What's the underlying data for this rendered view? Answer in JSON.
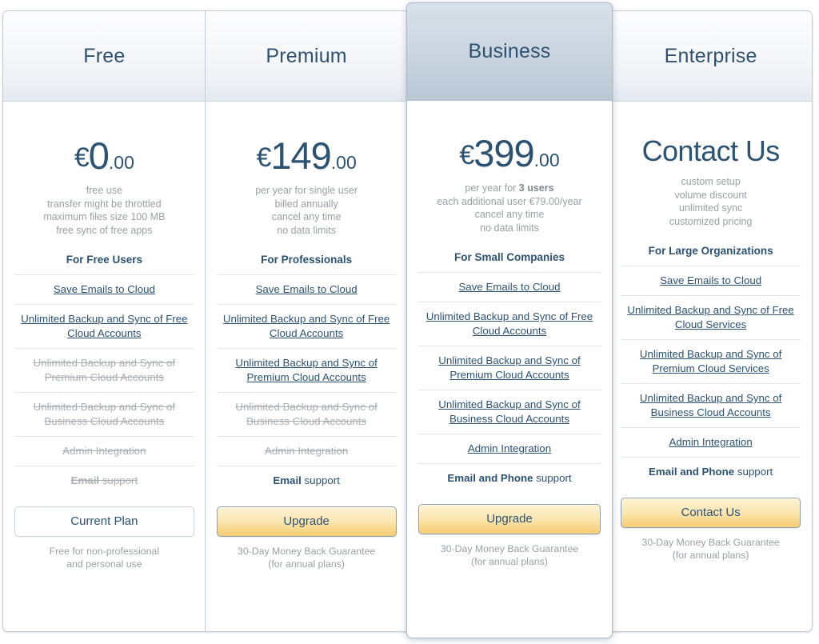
{
  "page": {
    "title": "Pricing Plans"
  },
  "plans": [
    {
      "id": "free",
      "name": "Free",
      "featured": false,
      "price": {
        "currency": "€",
        "amount": "0",
        "cents": ".00",
        "is_contact": false
      },
      "notes": [
        {
          "text": "free use"
        },
        {
          "text": "transfer might be throttled"
        },
        {
          "text": "maximum files size 100 MB"
        },
        {
          "text": "free sync of free apps"
        }
      ],
      "audience": "For Free Users",
      "features": [
        {
          "label": "Save Emails to Cloud",
          "enabled": true
        },
        {
          "label": "Unlimited Backup and Sync of Free Cloud Accounts",
          "enabled": true
        },
        {
          "label": "Unlimited Backup and Sync of Premium Cloud Accounts",
          "enabled": false
        },
        {
          "label": "Unlimited Backup and Sync of Business Cloud Accounts",
          "enabled": false
        },
        {
          "label": "Admin Integration",
          "enabled": false
        }
      ],
      "support": {
        "bold": "Email",
        "rest": " support",
        "enabled": false
      },
      "cta": {
        "label": "Current Plan",
        "style": "neutral"
      },
      "cta_note": "Free for non-professional and personal use"
    },
    {
      "id": "premium",
      "name": "Premium",
      "featured": false,
      "price": {
        "currency": "€",
        "amount": "149",
        "cents": ".00",
        "is_contact": false
      },
      "notes": [
        {
          "text": "per year for single user"
        },
        {
          "text": "billed annually"
        },
        {
          "text": "cancel any time"
        },
        {
          "text": "no data limits"
        }
      ],
      "audience": "For Professionals",
      "features": [
        {
          "label": "Save Emails to Cloud",
          "enabled": true
        },
        {
          "label": "Unlimited Backup and Sync of Free Cloud Accounts",
          "enabled": true
        },
        {
          "label": "Unlimited Backup and Sync of Premium Cloud Accounts",
          "enabled": true
        },
        {
          "label": "Unlimited Backup and Sync of Business Cloud Accounts",
          "enabled": false
        },
        {
          "label": "Admin Integration",
          "enabled": false
        }
      ],
      "support": {
        "bold": "Email",
        "rest": " support",
        "enabled": true
      },
      "cta": {
        "label": "Upgrade",
        "style": "primary"
      },
      "cta_note": "30-Day Money Back Guarantee (for annual plans)"
    },
    {
      "id": "business",
      "name": "Business",
      "featured": true,
      "price": {
        "currency": "€",
        "amount": "399",
        "cents": ".00",
        "is_contact": false
      },
      "notes": [
        {
          "text": "per year for ",
          "bold": "3 users",
          "after": ""
        },
        {
          "text": "each additional user €79.00/year"
        },
        {
          "text": "cancel any time"
        },
        {
          "text": "no data limits"
        }
      ],
      "audience": "For Small Companies",
      "features": [
        {
          "label": "Save Emails to Cloud",
          "enabled": true
        },
        {
          "label": "Unlimited Backup and Sync of Free Cloud Accounts",
          "enabled": true
        },
        {
          "label": "Unlimited Backup and Sync of Premium Cloud Accounts",
          "enabled": true
        },
        {
          "label": "Unlimited Backup and Sync of Business Cloud Accounts",
          "enabled": true
        },
        {
          "label": "Admin Integration",
          "enabled": true
        }
      ],
      "support": {
        "bold": "Email and Phone",
        "rest": " support",
        "enabled": true
      },
      "cta": {
        "label": "Upgrade",
        "style": "primary"
      },
      "cta_note": "30-Day Money Back Guarantee (for annual plans)"
    },
    {
      "id": "enterprise",
      "name": "Enterprise",
      "featured": false,
      "price": {
        "currency": "",
        "amount": "Contact Us",
        "cents": "",
        "is_contact": true
      },
      "notes": [
        {
          "text": "custom setup"
        },
        {
          "text": "volume discount"
        },
        {
          "text": "unlimited sync"
        },
        {
          "text": "customized pricing"
        }
      ],
      "audience": "For Large Organizations",
      "features": [
        {
          "label": "Save Emails to Cloud",
          "enabled": true
        },
        {
          "label": "Unlimited Backup and Sync of Free Cloud Services",
          "enabled": true
        },
        {
          "label": "Unlimited Backup and Sync of Premium Cloud Services",
          "enabled": true
        },
        {
          "label": "Unlimited Backup and Sync of Business Cloud Accounts",
          "enabled": true
        },
        {
          "label": "Admin Integration",
          "enabled": true
        }
      ],
      "support": {
        "bold": "Email and Phone",
        "rest": " support",
        "enabled": true
      },
      "cta": {
        "label": "Contact Us",
        "style": "primary"
      },
      "cta_note": "30-Day Money Back Guarantee (for annual plans)"
    }
  ],
  "colors": {
    "heading_blue": "#2c5273",
    "muted_gray": "#9a9fa5",
    "disabled_gray": "#a9aeb4",
    "panel_border": "#c3ccd6",
    "row_divider": "#e2e5e9",
    "cta_gold_top": "#fdf2d4",
    "cta_gold_bottom": "#f5cd73",
    "featured_head_top": "#d7e0e8",
    "featured_head_bottom": "#b9c7d5"
  }
}
